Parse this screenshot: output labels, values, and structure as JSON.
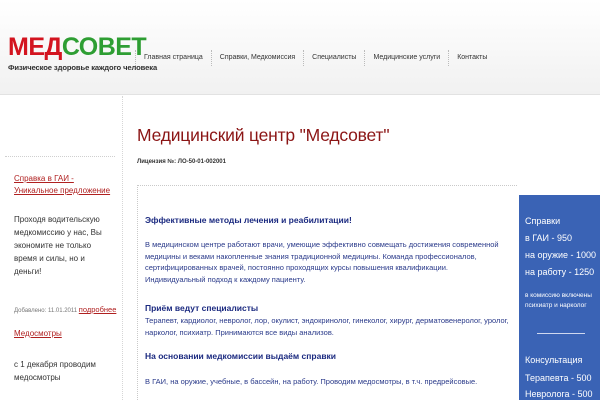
{
  "logo": {
    "part1": "МЕД",
    "part2": "СОВЕТ",
    "tagline": "Физическое здоровье каждого человека"
  },
  "nav": [
    {
      "label": "Главная страница"
    },
    {
      "label": "Справки, Медкомиссия"
    },
    {
      "label": "Специалисты"
    },
    {
      "label": "Медицинские услуги"
    },
    {
      "label": "Контакты"
    }
  ],
  "sidebar": {
    "link1": "Справка в ГАИ - Уникальное предложение",
    "text1": "Проходя водительскую медкомиссию у нас, Вы экономите не только время и силы, но и деньги!",
    "date": "Добавлено: 11.01.2011",
    "more": "подробнее",
    "link2": "Медосмотры",
    "text2": "с 1 декабря проводим медосмотры"
  },
  "main": {
    "title": "Медицинский центр \"Медсовет\"",
    "license": "Лицензия №: ЛО-50-01-002001",
    "heading1": "Эффективные методы лечения и реабилитации!",
    "para1": "В медицинском центре работают врачи, умеющие эффективно совмещать достижения современной медицины и веками накопленные знания традиционной медицины. Команда профессионалов, сертифицированных врачей, постоянно проходящих курсы повышения квалификации. Индивидуальный подход к каждому пациенту.",
    "heading2": "Приём ведут специалисты",
    "para2": "Терапевт, кардиолог, невролог, лор, окулист, эндокринолог, гинеколог, хирург, дерматовенеролог, уролог, нарколог, психиатр. Принимаются все виды анализов.",
    "heading3": "На основании медкомиссии выдаём справки",
    "para3": "В ГАИ, на оружие, учебные, в бассейн, на работу. Проводим медосмотры, в т.ч. предрейсовые."
  },
  "promo": {
    "l1": "Справки",
    "l2": "в ГАИ - 950",
    "l3": "на оружие - 1000",
    "l4": "на работу - 1250",
    "small": "в комиссию включены психиатр и нарколог",
    "l5": "Консультация",
    "l6": "Терапевта - 500",
    "l7": "Невролога - 500"
  }
}
